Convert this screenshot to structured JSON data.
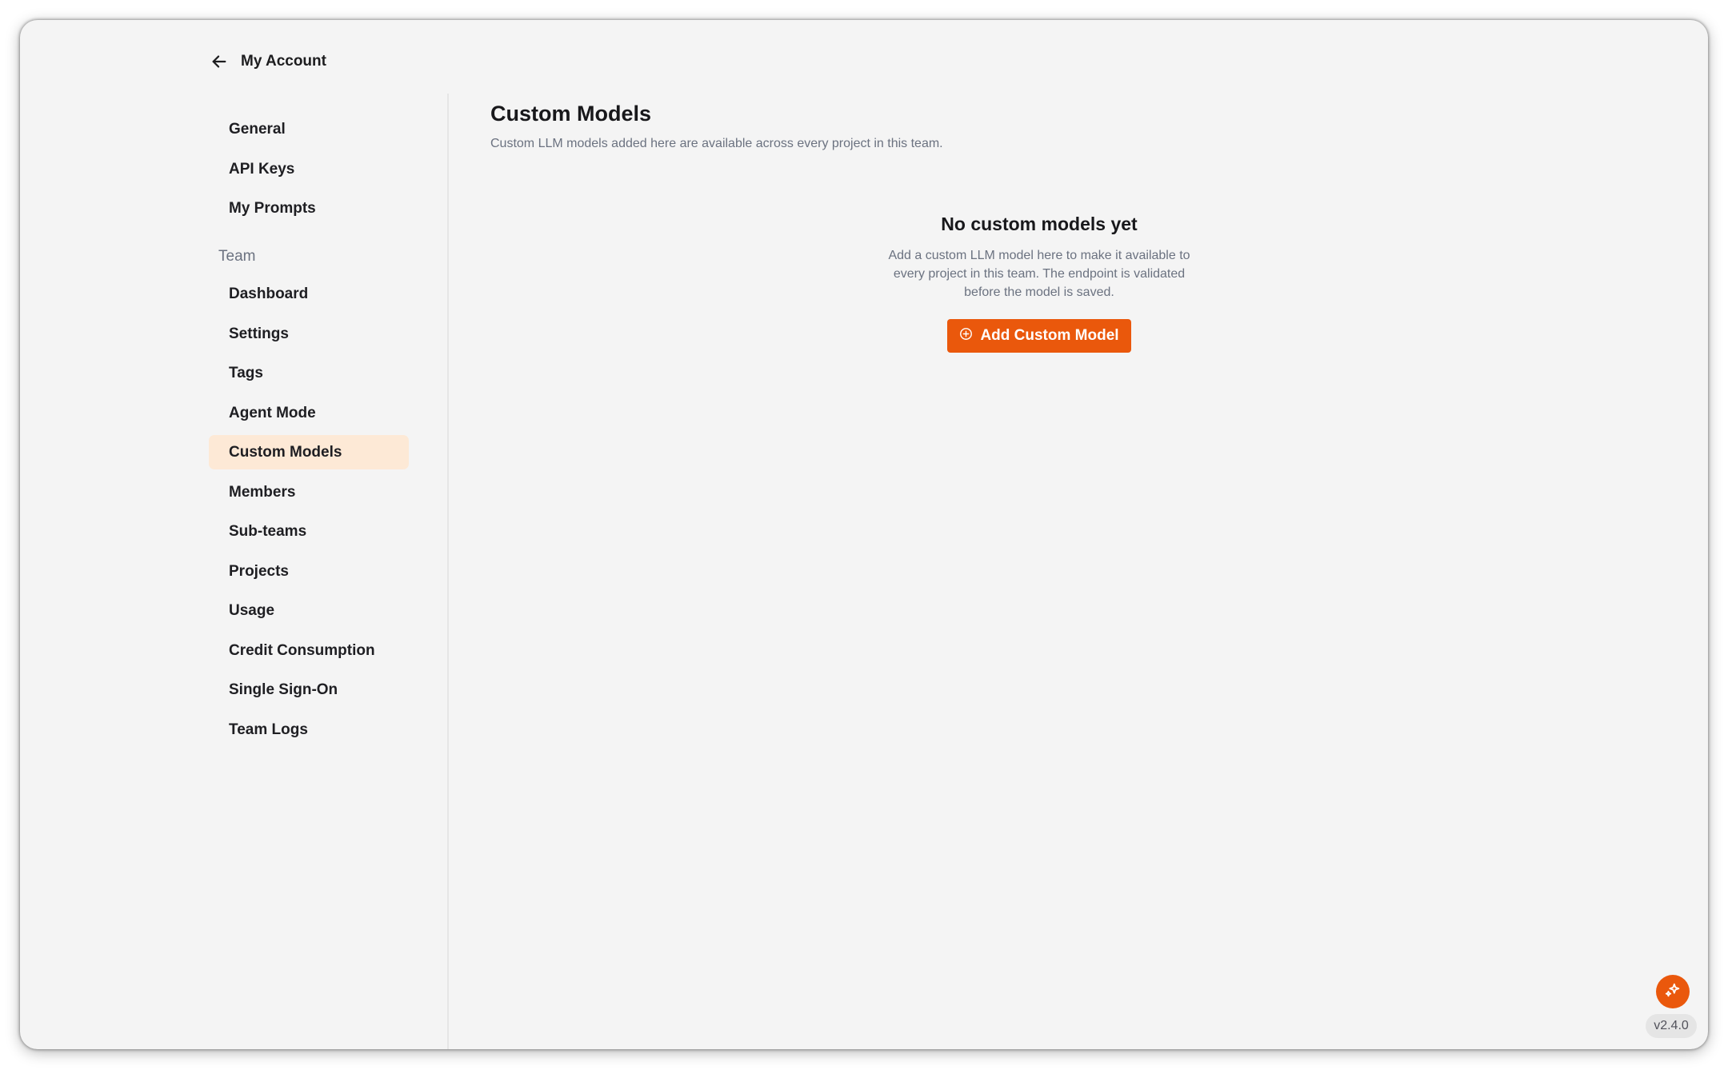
{
  "header": {
    "back_label": "My Account"
  },
  "sidebar": {
    "account_items": [
      {
        "label": "General"
      },
      {
        "label": "API Keys"
      },
      {
        "label": "My Prompts"
      }
    ],
    "team_section_label": "Team",
    "team_items": [
      {
        "label": "Dashboard"
      },
      {
        "label": "Settings"
      },
      {
        "label": "Tags"
      },
      {
        "label": "Agent Mode"
      },
      {
        "label": "Custom Models",
        "active": true
      },
      {
        "label": "Members"
      },
      {
        "label": "Sub-teams"
      },
      {
        "label": "Projects"
      },
      {
        "label": "Usage"
      },
      {
        "label": "Credit Consumption"
      },
      {
        "label": "Single Sign-On"
      },
      {
        "label": "Team Logs"
      }
    ]
  },
  "main": {
    "title": "Custom Models",
    "subtitle": "Custom LLM models added here are available across every project in this team.",
    "empty_state": {
      "title": "No custom models yet",
      "description": "Add a custom LLM model here to make it available to every project in this team. The endpoint is validated before the model is saved.",
      "button_label": "Add Custom Model"
    }
  },
  "footer": {
    "version": "v2.4.0"
  },
  "colors": {
    "accent": "#ea580c",
    "active_nav_bg": "#fde9d6",
    "background": "#f4f4f4"
  },
  "icons": {
    "back": "arrow-left-icon",
    "add": "plus-circle-icon",
    "assistant": "sparkles-icon"
  }
}
